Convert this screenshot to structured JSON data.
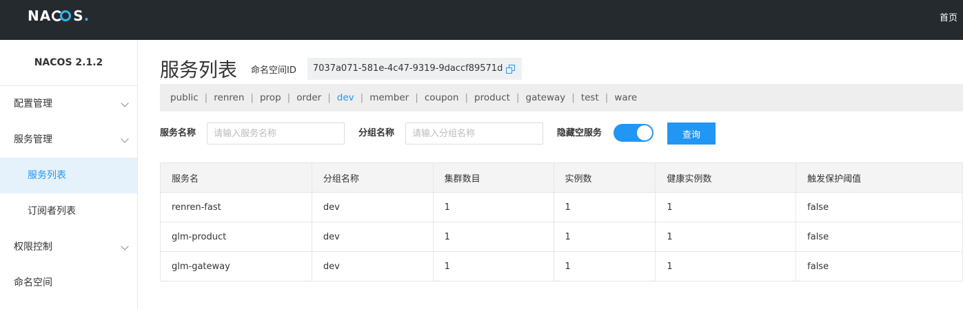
{
  "header": {
    "logo_text_pre": "NA",
    "logo_text_post": "S",
    "logo_dot": ".",
    "home_link": "首页"
  },
  "sidebar": {
    "version": "NACOS 2.1.2",
    "items": [
      {
        "label": "配置管理",
        "expandable": true
      },
      {
        "label": "服务管理",
        "expandable": true
      },
      {
        "label": "服务列表",
        "sub": true,
        "active": true
      },
      {
        "label": "订阅者列表",
        "sub": true
      },
      {
        "label": "权限控制",
        "expandable": true
      },
      {
        "label": "命名空间"
      }
    ]
  },
  "main": {
    "title": "服务列表",
    "namespace_label": "命名空间ID",
    "namespace_id": "7037a071-581e-4c47-9319-9daccf89571d",
    "namespaces": [
      "public",
      "renren",
      "prop",
      "order",
      "dev",
      "member",
      "coupon",
      "product",
      "gateway",
      "test",
      "ware"
    ],
    "active_namespace": "dev"
  },
  "filter": {
    "service_name_label": "服务名称",
    "service_name_placeholder": "请输入服务名称",
    "group_name_label": "分组名称",
    "group_name_placeholder": "请输入分组名称",
    "hide_empty_label": "隐藏空服务",
    "hide_empty_on": true,
    "query_button": "查询"
  },
  "table": {
    "columns": [
      "服务名",
      "分组名称",
      "集群数目",
      "实例数",
      "健康实例数",
      "触发保护阈值"
    ],
    "rows": [
      [
        "renren-fast",
        "dev",
        "1",
        "1",
        "1",
        "false"
      ],
      [
        "glm-product",
        "dev",
        "1",
        "1",
        "1",
        "false"
      ],
      [
        "glm-gateway",
        "dev",
        "1",
        "1",
        "1",
        "false"
      ]
    ]
  },
  "colors": {
    "accent": "#2196f3",
    "header_bg": "#252a2f",
    "logo_accent": "#2fb8f0"
  }
}
